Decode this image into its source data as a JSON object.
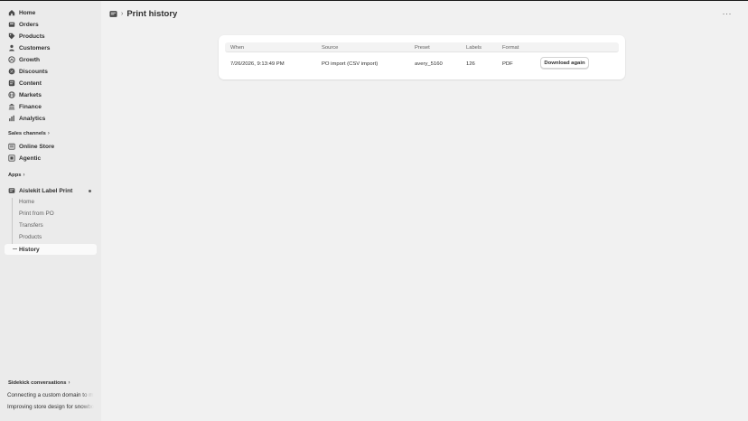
{
  "sidebar": {
    "nav": [
      {
        "label": "Home",
        "icon": "home-icon"
      },
      {
        "label": "Orders",
        "icon": "orders-icon"
      },
      {
        "label": "Products",
        "icon": "tag-icon"
      },
      {
        "label": "Customers",
        "icon": "person-icon"
      },
      {
        "label": "Growth",
        "icon": "growth-icon"
      },
      {
        "label": "Discounts",
        "icon": "discount-icon"
      },
      {
        "label": "Content",
        "icon": "content-icon"
      },
      {
        "label": "Markets",
        "icon": "globe-icon"
      },
      {
        "label": "Finance",
        "icon": "bank-icon"
      },
      {
        "label": "Analytics",
        "icon": "bar-chart-icon"
      }
    ],
    "sales_channels_label": "Sales channels",
    "channels": [
      {
        "label": "Online Store",
        "icon": "store-icon"
      },
      {
        "label": "Agentic",
        "icon": "agentic-icon"
      }
    ],
    "apps_label": "Apps",
    "app": {
      "label": "Aislekit Label Print",
      "subitems": [
        "Home",
        "Print from PO",
        "Transfers",
        "Products"
      ],
      "active_item": "History"
    },
    "sidekick_label": "Sidekick conversations",
    "conversations": [
      "Connecting a custom domain to my store",
      "Improving store design for snowboards"
    ]
  },
  "header": {
    "title": "Print history"
  },
  "table": {
    "columns": [
      "When",
      "Source",
      "Preset",
      "Labels",
      "Format"
    ],
    "rows": [
      {
        "when": "7/26/2026, 9:13:49 PM",
        "source": "PO import (CSV import)",
        "preset": "avery_5160",
        "labels": "126",
        "format": "PDF",
        "action": "Download again"
      }
    ]
  }
}
